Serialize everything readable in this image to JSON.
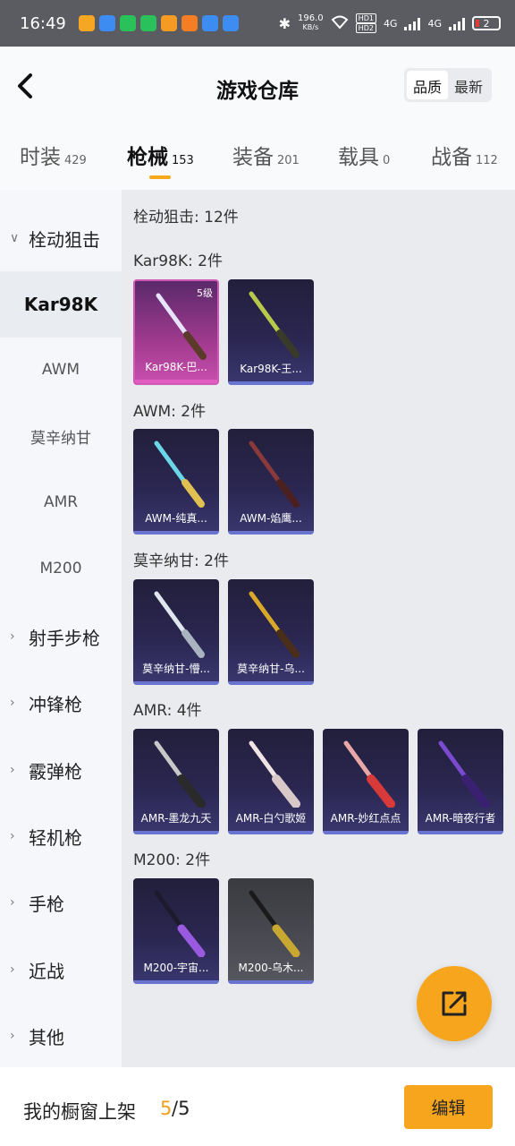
{
  "status_bar": {
    "time": "16:49",
    "net_speed_value": "196.0",
    "net_speed_unit": "KB/s",
    "hd_badge_1": "HD1",
    "hd_badge_2": "HD2",
    "network_1": "4G",
    "network_2": "4G",
    "battery": "2",
    "app_icon_colors": [
      "#f5a623",
      "#3d8cf2",
      "#2ac05a",
      "#2ac05a",
      "#f59a23",
      "#f57d23",
      "#3d8cf2",
      "#3d8cf2"
    ]
  },
  "header": {
    "title": "游戏仓库",
    "back_icon": "chevron-left-icon",
    "sort_options": [
      "品质",
      "最新"
    ],
    "active_sort": "品质"
  },
  "tabs": [
    {
      "label": "时装",
      "count": "429"
    },
    {
      "label": "枪械",
      "count": "153",
      "active": true
    },
    {
      "label": "装备",
      "count": "201"
    },
    {
      "label": "载具",
      "count": "0"
    },
    {
      "label": "战备",
      "count": "112"
    }
  ],
  "sidebar": {
    "items": [
      {
        "label": "栓动狙击",
        "icon": "chevron-down-icon"
      },
      {
        "label": "Kar98K"
      },
      {
        "label": "AWM"
      },
      {
        "label": "莫辛纳甘"
      },
      {
        "label": "AMR"
      },
      {
        "label": "M200"
      },
      {
        "label": "射手步枪",
        "icon": "chevron-right-icon"
      },
      {
        "label": "冲锋枪",
        "icon": "chevron-right-icon"
      },
      {
        "label": "霰弹枪",
        "icon": "chevron-right-icon"
      },
      {
        "label": "轻机枪",
        "icon": "chevron-right-icon"
      },
      {
        "label": "手枪",
        "icon": "chevron-right-icon"
      },
      {
        "label": "近战",
        "icon": "chevron-right-icon"
      },
      {
        "label": "其他",
        "icon": "chevron-right-icon"
      }
    ]
  },
  "content": {
    "category_summary": "栓动狙击: 12件",
    "groups": [
      {
        "title": "Kar98K: 2件",
        "items": [
          {
            "name": "Kar98K-巴...",
            "level": "5级",
            "rarity": "pink"
          },
          {
            "name": "Kar98K-王...",
            "rarity": "purple"
          }
        ]
      },
      {
        "title": "AWM: 2件",
        "items": [
          {
            "name": "AWM-纯真...",
            "rarity": "purple"
          },
          {
            "name": "AWM-焰鹰...",
            "rarity": "purple"
          }
        ]
      },
      {
        "title": "莫辛纳甘: 2件",
        "items": [
          {
            "name": "莫辛纳甘-懵...",
            "rarity": "purple"
          },
          {
            "name": "莫辛纳甘-乌...",
            "rarity": "purple"
          }
        ]
      },
      {
        "title": "AMR: 4件",
        "items": [
          {
            "name": "AMR-墨龙九天",
            "rarity": "purple"
          },
          {
            "name": "AMR-白勺歌姬",
            "rarity": "purple"
          },
          {
            "name": "AMR-妙红点点",
            "rarity": "purple"
          },
          {
            "name": "AMR-暗夜行者",
            "rarity": "purple"
          }
        ]
      },
      {
        "title": "M200: 2件",
        "items": [
          {
            "name": "M200-宇宙...",
            "rarity": "purple"
          },
          {
            "name": "M200-乌木...",
            "rarity": "gray"
          }
        ]
      }
    ]
  },
  "fab": {
    "icon": "share-icon"
  },
  "bottom_bar": {
    "label": "我的橱窗上架",
    "current": "5",
    "total": "/5",
    "edit_label": "编辑"
  },
  "colors": {
    "accent": "#f7a51c",
    "pink_rarity": "#c84fae",
    "purple_rarity": "#2a2650",
    "gray_rarity": "#4a4b52"
  }
}
